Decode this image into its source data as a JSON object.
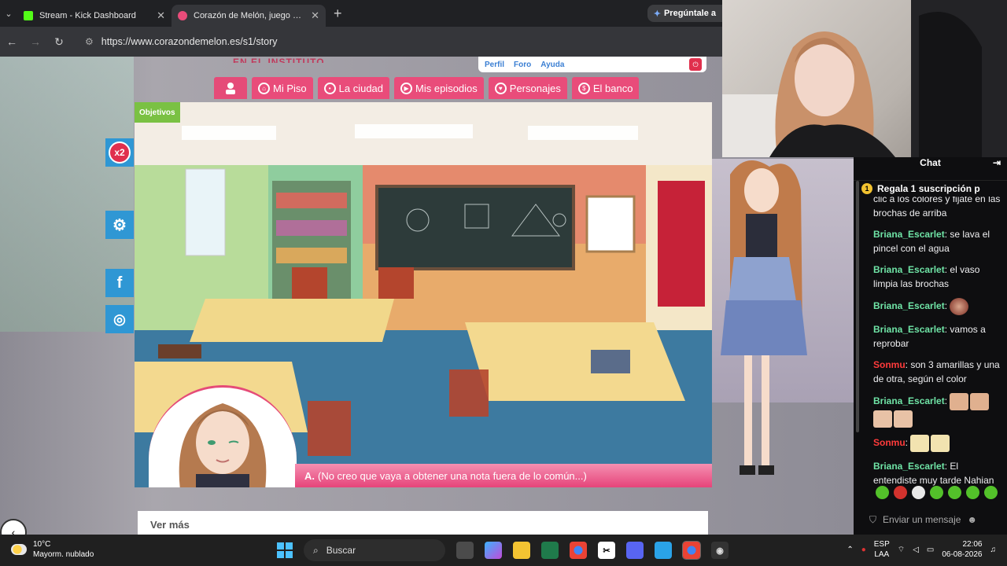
{
  "browser": {
    "tabs": [
      {
        "title": "Stream - Kick Dashboard",
        "active": false,
        "favicon_color": "#53fc18"
      },
      {
        "title": "Corazón de Melón, juego de ar",
        "active": true,
        "favicon_color": "#e94c7a"
      }
    ],
    "gemini_label": "Pregúntale a",
    "url": "https://www.corazondemelon.es/s1/story"
  },
  "site": {
    "logo_text": "EN EL INSTITUTO",
    "top_links": [
      "Perfil",
      "Foro",
      "Ayuda"
    ],
    "nav": [
      {
        "label": "Mi Piso",
        "icon": "home-icon"
      },
      {
        "label": "La ciudad",
        "icon": "map-pin-icon"
      },
      {
        "label": "Mis episodios",
        "icon": "play-icon"
      },
      {
        "label": "Personajes",
        "icon": "heart-icon"
      },
      {
        "label": "El banco",
        "icon": "bank-icon"
      }
    ],
    "objectives_label": "Objetivos",
    "x2_badge": "x2",
    "dialogue": {
      "speaker": "A.",
      "text": "(No creo que vaya a obtener una nota fuera de lo común...)"
    },
    "ver_mas": "Ver más"
  },
  "chat": {
    "title": "Chat",
    "sub_banner": "Regala 1 suscripción p",
    "messages": [
      {
        "user": "",
        "text": "clic a los colores y fijate en las brochas de arriba",
        "color": "#efeff1"
      },
      {
        "user": "Briana_Escarlet",
        "text": ": se lava el pincel con el agua",
        "color": "#6fe4a6"
      },
      {
        "user": "Briana_Escarlet",
        "text": ": el vaso limpia las brochas",
        "color": "#6fe4a6"
      },
      {
        "user": "Briana_Escarlet",
        "text": ":",
        "color": "#6fe4a6",
        "emotes": 1
      },
      {
        "user": "Briana_Escarlet",
        "text": ": vamos a reprobar",
        "color": "#6fe4a6"
      },
      {
        "user": "Sonmu",
        "text": ": son 3 amarillas y una de otra, según el color",
        "color": "#ff3b3b"
      },
      {
        "user": "Briana_Escarlet",
        "text": ":",
        "color": "#6fe4a6",
        "emotes": 4
      },
      {
        "user": "Sonmu",
        "text": ":",
        "color": "#ff3b3b",
        "emotes": 2
      },
      {
        "user": "Briana_Escarlet",
        "text": ": El entendiste muy tarde Nahian",
        "color": "#6fe4a6"
      }
    ],
    "input_placeholder": "Enviar un mensaje"
  },
  "taskbar": {
    "weather_temp": "10°C",
    "weather_desc": "Mayorm. nublado",
    "search_label": "Buscar",
    "lang_top": "ESP",
    "lang_bottom": "LAA",
    "time": "22:06",
    "date": "06-08-2026"
  }
}
